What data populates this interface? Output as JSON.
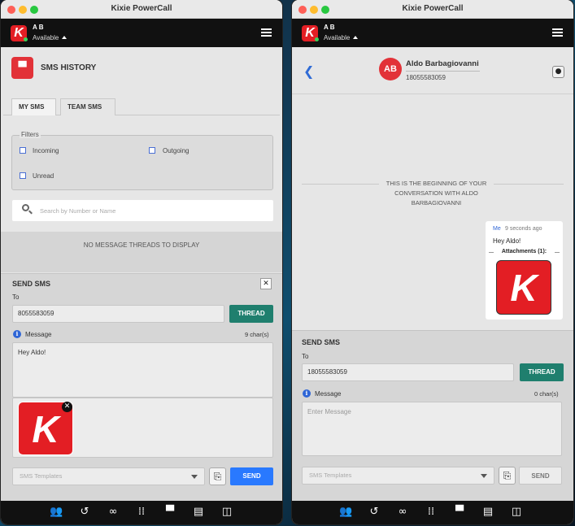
{
  "app": {
    "title": "Kixie PowerCall",
    "user_name": "A B",
    "user_status": "Available",
    "logo_letter": "K",
    "brand_color": "#e31e24"
  },
  "history": {
    "title": "SMS HISTORY",
    "tabs": [
      {
        "label": "MY SMS",
        "active": true
      },
      {
        "label": "TEAM SMS",
        "active": false
      }
    ],
    "filters_label": "Filters",
    "filters": [
      {
        "label": "Incoming"
      },
      {
        "label": "Outgoing"
      },
      {
        "label": "Unread"
      }
    ],
    "search_placeholder": "Search by Number or Name",
    "empty_message": "NO MESSAGE THREADS TO DISPLAY"
  },
  "send_left": {
    "title": "SEND SMS",
    "to_label": "To",
    "to_value": "8055583059",
    "thread_label": "THREAD",
    "message_label": "Message",
    "char_count": "9 char(s)",
    "message_text": "Hey Aldo!",
    "templates_placeholder": "SMS Templates",
    "send_label": "SEND"
  },
  "conversation": {
    "contact_initials": "AB",
    "contact_name": "Aldo Barbagiovanni",
    "contact_number": "18055583059",
    "begin_text": "THIS IS THE BEGINNING OF YOUR CONVERSATION WITH ALDO BARBAGIOVANNI",
    "message": {
      "sender": "Me",
      "time": "9 seconds ago",
      "text": "Hey Aldo!",
      "attachments_label": "Attachments (1):"
    }
  },
  "send_right": {
    "title": "SEND SMS",
    "to_label": "To",
    "to_value": "18055583059",
    "thread_label": "THREAD",
    "message_label": "Message",
    "char_count": "0 char(s)",
    "message_placeholder": "Enter Message",
    "templates_placeholder": "SMS Templates",
    "send_label": "SEND"
  },
  "nav_icons": [
    "contacts-icon",
    "history-icon",
    "voicemail-icon",
    "dialpad-icon",
    "sms-icon",
    "chat-icon",
    "panel-icon"
  ]
}
